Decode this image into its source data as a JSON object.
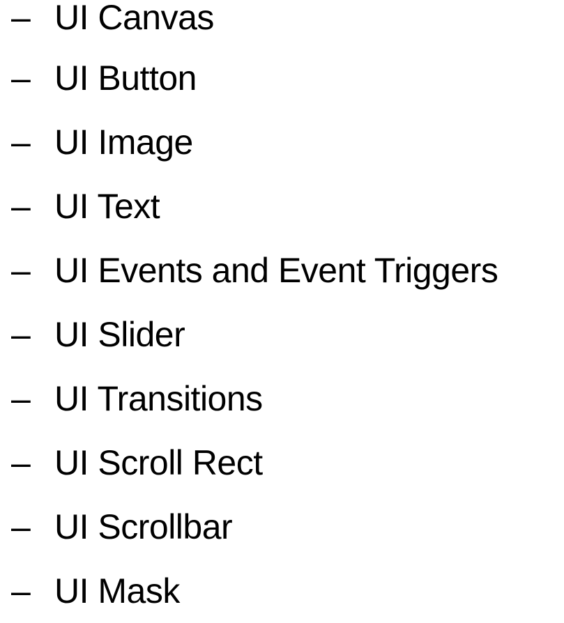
{
  "bullet_glyph": "–",
  "topics": [
    {
      "label": "UI Canvas"
    },
    {
      "label": "UI Button"
    },
    {
      "label": "UI Image"
    },
    {
      "label": "UI Text"
    },
    {
      "label": "UI Events and Event Triggers"
    },
    {
      "label": "UI Slider"
    },
    {
      "label": "UI Transitions"
    },
    {
      "label": "UI Scroll Rect"
    },
    {
      "label": "UI Scrollbar"
    },
    {
      "label": "UI Mask"
    }
  ]
}
